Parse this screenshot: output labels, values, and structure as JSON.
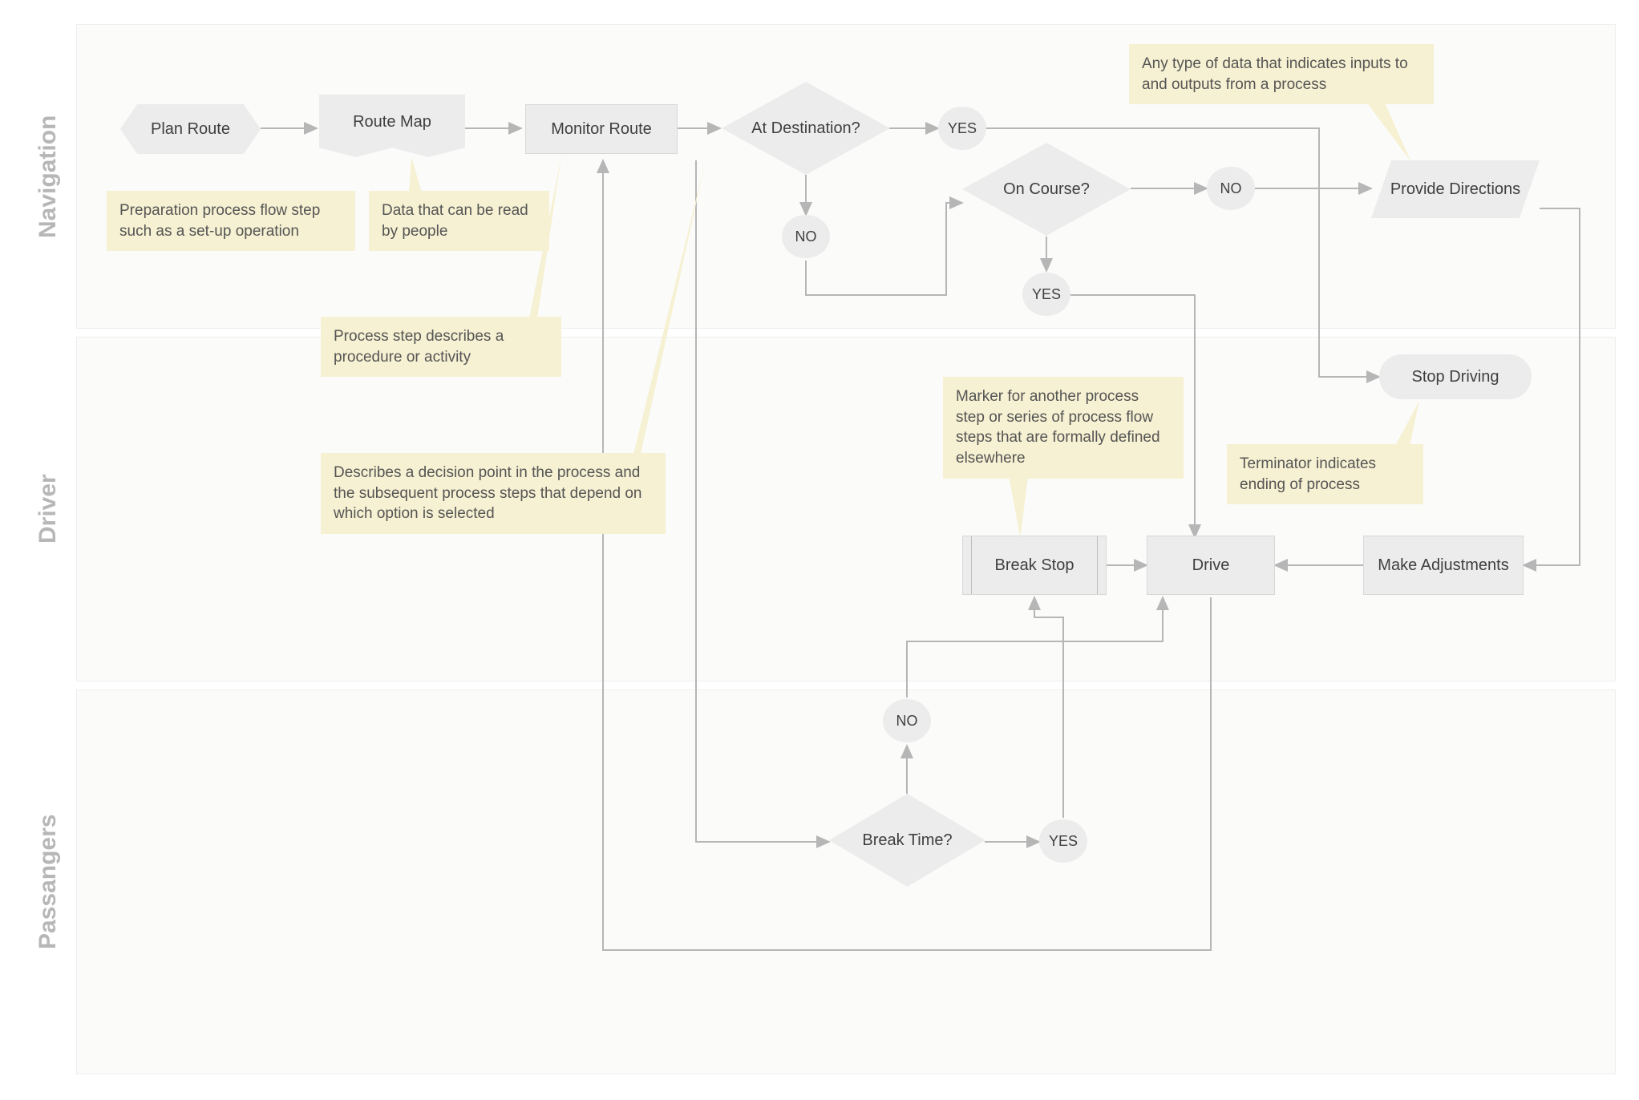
{
  "lanes": {
    "navigation": "Navigation",
    "driver": "Driver",
    "passengers": "Passangers"
  },
  "shapes": {
    "plan_route": "Plan Route",
    "route_map": "Route Map",
    "monitor_route": "Monitor Route",
    "at_destination": "At Destination?",
    "yes_dest": "YES",
    "no_dest": "NO",
    "on_course": "On Course?",
    "yes_course": "YES",
    "no_course": "NO",
    "provide_directions": "Provide Directions",
    "stop_driving": "Stop Driving",
    "break_stop": "Break Stop",
    "drive": "Drive",
    "make_adjustments": "Make Adjustments",
    "break_time": "Break Time?",
    "yes_break": "YES",
    "no_break": "NO"
  },
  "callouts": {
    "prep": "Preparation process flow step such as a set-up operation",
    "doc": "Data that can be read by people",
    "process": "Process step describes a procedure or activity",
    "decision": "Describes a decision point in the process and the subsequent process steps that depend on which option is selected",
    "data": "Any type of data that indicates inputs to and outputs from a process",
    "predef": "Marker for another process step or series of process flow steps that are formally defined elsewhere",
    "terminator": "Terminator indicates ending of process"
  }
}
